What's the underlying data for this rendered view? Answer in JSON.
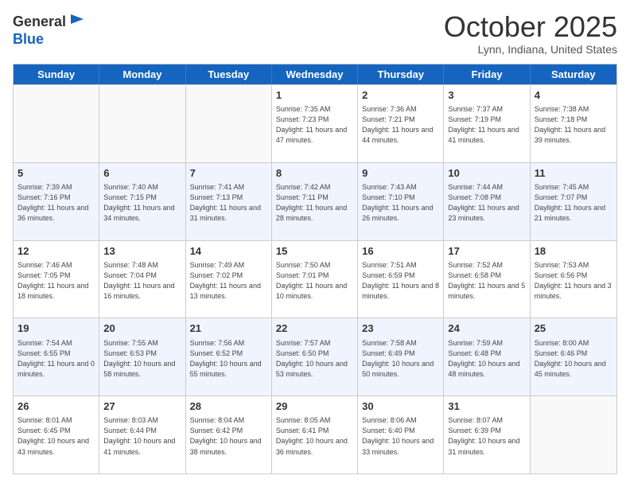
{
  "header": {
    "logo_line1": "General",
    "logo_line2": "Blue",
    "month": "October 2025",
    "location": "Lynn, Indiana, United States"
  },
  "weekdays": [
    "Sunday",
    "Monday",
    "Tuesday",
    "Wednesday",
    "Thursday",
    "Friday",
    "Saturday"
  ],
  "rows": [
    [
      {
        "date": "",
        "info": ""
      },
      {
        "date": "",
        "info": ""
      },
      {
        "date": "",
        "info": ""
      },
      {
        "date": "1",
        "info": "Sunrise: 7:35 AM\nSunset: 7:23 PM\nDaylight: 11 hours and 47 minutes."
      },
      {
        "date": "2",
        "info": "Sunrise: 7:36 AM\nSunset: 7:21 PM\nDaylight: 11 hours and 44 minutes."
      },
      {
        "date": "3",
        "info": "Sunrise: 7:37 AM\nSunset: 7:19 PM\nDaylight: 11 hours and 41 minutes."
      },
      {
        "date": "4",
        "info": "Sunrise: 7:38 AM\nSunset: 7:18 PM\nDaylight: 11 hours and 39 minutes."
      }
    ],
    [
      {
        "date": "5",
        "info": "Sunrise: 7:39 AM\nSunset: 7:16 PM\nDaylight: 11 hours and 36 minutes."
      },
      {
        "date": "6",
        "info": "Sunrise: 7:40 AM\nSunset: 7:15 PM\nDaylight: 11 hours and 34 minutes."
      },
      {
        "date": "7",
        "info": "Sunrise: 7:41 AM\nSunset: 7:13 PM\nDaylight: 11 hours and 31 minutes."
      },
      {
        "date": "8",
        "info": "Sunrise: 7:42 AM\nSunset: 7:11 PM\nDaylight: 11 hours and 28 minutes."
      },
      {
        "date": "9",
        "info": "Sunrise: 7:43 AM\nSunset: 7:10 PM\nDaylight: 11 hours and 26 minutes."
      },
      {
        "date": "10",
        "info": "Sunrise: 7:44 AM\nSunset: 7:08 PM\nDaylight: 11 hours and 23 minutes."
      },
      {
        "date": "11",
        "info": "Sunrise: 7:45 AM\nSunset: 7:07 PM\nDaylight: 11 hours and 21 minutes."
      }
    ],
    [
      {
        "date": "12",
        "info": "Sunrise: 7:46 AM\nSunset: 7:05 PM\nDaylight: 11 hours and 18 minutes."
      },
      {
        "date": "13",
        "info": "Sunrise: 7:48 AM\nSunset: 7:04 PM\nDaylight: 11 hours and 16 minutes."
      },
      {
        "date": "14",
        "info": "Sunrise: 7:49 AM\nSunset: 7:02 PM\nDaylight: 11 hours and 13 minutes."
      },
      {
        "date": "15",
        "info": "Sunrise: 7:50 AM\nSunset: 7:01 PM\nDaylight: 11 hours and 10 minutes."
      },
      {
        "date": "16",
        "info": "Sunrise: 7:51 AM\nSunset: 6:59 PM\nDaylight: 11 hours and 8 minutes."
      },
      {
        "date": "17",
        "info": "Sunrise: 7:52 AM\nSunset: 6:58 PM\nDaylight: 11 hours and 5 minutes."
      },
      {
        "date": "18",
        "info": "Sunrise: 7:53 AM\nSunset: 6:56 PM\nDaylight: 11 hours and 3 minutes."
      }
    ],
    [
      {
        "date": "19",
        "info": "Sunrise: 7:54 AM\nSunset: 6:55 PM\nDaylight: 11 hours and 0 minutes."
      },
      {
        "date": "20",
        "info": "Sunrise: 7:55 AM\nSunset: 6:53 PM\nDaylight: 10 hours and 58 minutes."
      },
      {
        "date": "21",
        "info": "Sunrise: 7:56 AM\nSunset: 6:52 PM\nDaylight: 10 hours and 55 minutes."
      },
      {
        "date": "22",
        "info": "Sunrise: 7:57 AM\nSunset: 6:50 PM\nDaylight: 10 hours and 53 minutes."
      },
      {
        "date": "23",
        "info": "Sunrise: 7:58 AM\nSunset: 6:49 PM\nDaylight: 10 hours and 50 minutes."
      },
      {
        "date": "24",
        "info": "Sunrise: 7:59 AM\nSunset: 6:48 PM\nDaylight: 10 hours and 48 minutes."
      },
      {
        "date": "25",
        "info": "Sunrise: 8:00 AM\nSunset: 6:46 PM\nDaylight: 10 hours and 45 minutes."
      }
    ],
    [
      {
        "date": "26",
        "info": "Sunrise: 8:01 AM\nSunset: 6:45 PM\nDaylight: 10 hours and 43 minutes."
      },
      {
        "date": "27",
        "info": "Sunrise: 8:03 AM\nSunset: 6:44 PM\nDaylight: 10 hours and 41 minutes."
      },
      {
        "date": "28",
        "info": "Sunrise: 8:04 AM\nSunset: 6:42 PM\nDaylight: 10 hours and 38 minutes."
      },
      {
        "date": "29",
        "info": "Sunrise: 8:05 AM\nSunset: 6:41 PM\nDaylight: 10 hours and 36 minutes."
      },
      {
        "date": "30",
        "info": "Sunrise: 8:06 AM\nSunset: 6:40 PM\nDaylight: 10 hours and 33 minutes."
      },
      {
        "date": "31",
        "info": "Sunrise: 8:07 AM\nSunset: 6:39 PM\nDaylight: 10 hours and 31 minutes."
      },
      {
        "date": "",
        "info": ""
      }
    ]
  ]
}
